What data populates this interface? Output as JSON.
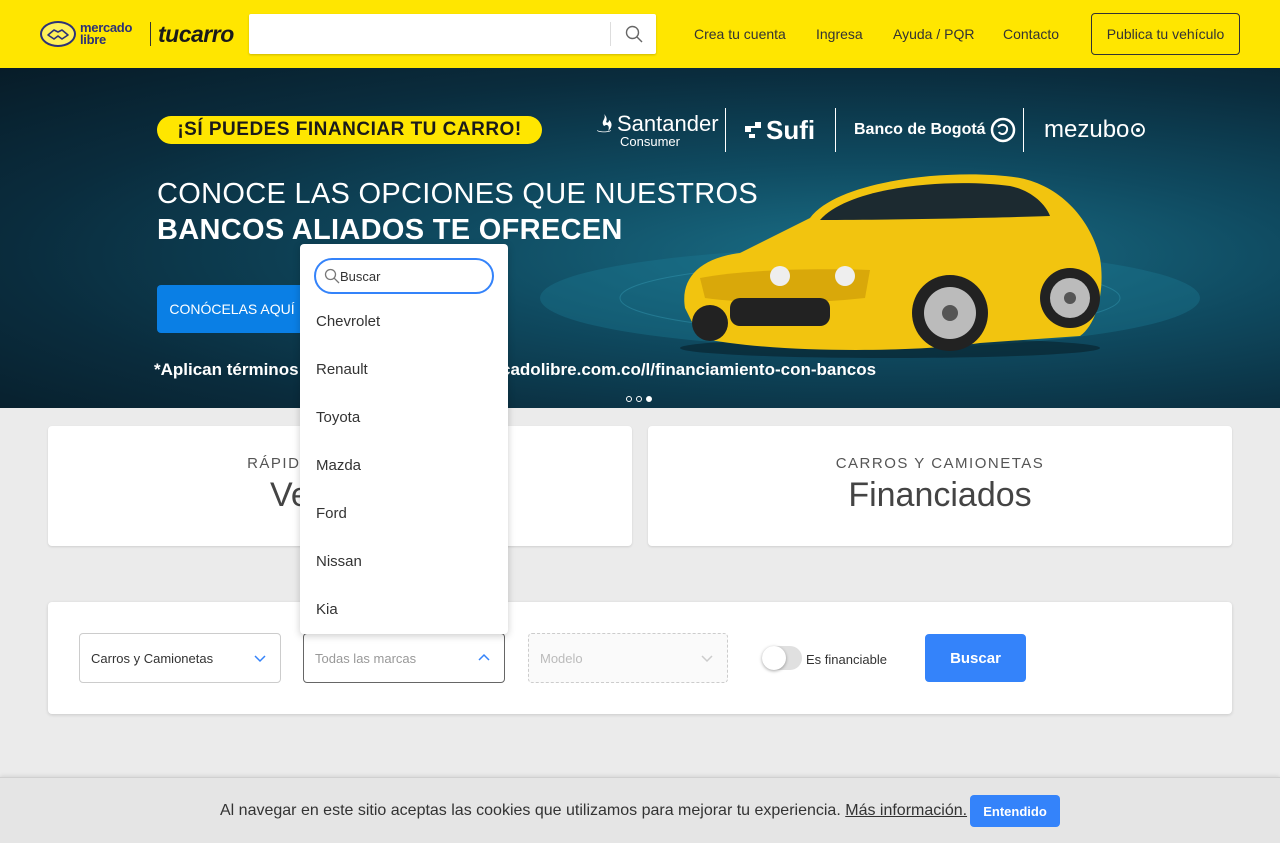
{
  "header": {
    "logo_brand": "mercado libre",
    "logo_site": "tucarro",
    "search": {
      "value": "",
      "placeholder": ""
    },
    "nav": [
      "Crea tu cuenta",
      "Ingresa",
      "Ayuda / PQR",
      "Contacto"
    ],
    "publish_label": "Publica tu vehículo"
  },
  "banner": {
    "pill": "¡SÍ PUEDES FINANCIAR TU CARRO!",
    "banks": [
      "Santander",
      "Consumer",
      "Sufi",
      "Banco de Bogotá",
      "mezubo"
    ],
    "title_line1": "CONOCE LAS OPCIONES QUE NUESTROS",
    "title_line2": "BANCOS ALIADOS TE OFRECEN",
    "cta": "CONÓCELAS AQUÍ",
    "terms": "*Aplican términos y condiciones. www.mercadolibre.com.co/l/financiamiento-con-bancos",
    "slide_count": 3,
    "active_slide": 3
  },
  "cards": [
    {
      "sub": "RÁPIDOS Y SEGUROS",
      "title": "Vendidos"
    },
    {
      "sub": "CARROS Y CAMIONETAS",
      "title": "Financiados"
    }
  ],
  "filters": {
    "category": "Carros y Camionetas",
    "brand": "Todas las marcas",
    "model": "Modelo",
    "financiable_label": "Es financiable",
    "financiable_on": false,
    "search_label": "Buscar"
  },
  "brand_dropdown": {
    "search_placeholder": "Buscar",
    "items": [
      "Chevrolet",
      "Renault",
      "Toyota",
      "Mazda",
      "Ford",
      "Nissan",
      "Kia"
    ]
  },
  "cookie": {
    "text": "Al navegar en este sitio aceptas las cookies que utilizamos para mejorar tu experiencia.",
    "link": "Más información.",
    "button": "Entendido"
  },
  "colors": {
    "header_yellow": "#ffe600",
    "primary_blue": "#3483fa",
    "banner_button": "#0a7fe5"
  }
}
